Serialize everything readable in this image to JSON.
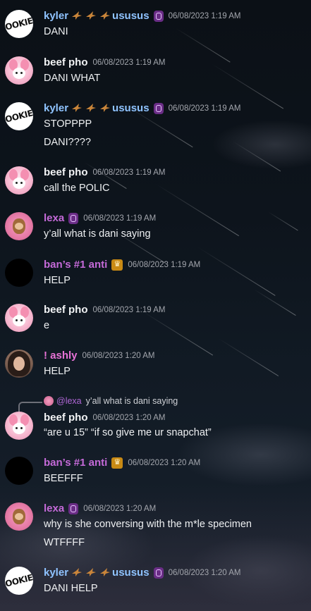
{
  "messages": [
    {
      "author": "kyler",
      "suffix": "ususus",
      "time": "06/08/2023 1:19 AM",
      "lines": [
        "DANI"
      ]
    },
    {
      "author": "beef pho",
      "time": "06/08/2023 1:19 AM",
      "lines": [
        "DANI WHAT"
      ]
    },
    {
      "author": "kyler",
      "suffix": "ususus",
      "time": "06/08/2023 1:19 AM",
      "lines": [
        "STOPPPP",
        "DANI????"
      ]
    },
    {
      "author": "beef pho",
      "time": "06/08/2023 1:19 AM",
      "lines": [
        "call the POLIC"
      ]
    },
    {
      "author": "lexa",
      "time": "06/08/2023 1:19 AM",
      "lines": [
        "y’all what is dani saying"
      ]
    },
    {
      "author": "ban’s #1 anti",
      "time": "06/08/2023 1:19 AM",
      "lines": [
        "HELP"
      ]
    },
    {
      "author": "beef pho",
      "time": "06/08/2023 1:19 AM",
      "lines": [
        "e"
      ]
    },
    {
      "author": "! ashly",
      "time": "06/08/2023 1:20 AM",
      "lines": [
        "HELP"
      ]
    },
    {
      "author": "beef pho",
      "time": "06/08/2023 1:20 AM",
      "reply": {
        "name": "@lexa",
        "text": "y’all what is dani saying"
      },
      "lines": [
        "“are u 15” “if so give me ur snapchat”"
      ]
    },
    {
      "author": "ban’s #1 anti",
      "time": "06/08/2023 1:20 AM",
      "lines": [
        "BEEFFF"
      ]
    },
    {
      "author": "lexa",
      "time": "06/08/2023 1:20 AM",
      "lines": [
        "why is she conversing with the m*le specimen",
        "WTFFFF"
      ]
    },
    {
      "author": "kyler",
      "suffix": "ususus",
      "time": "06/08/2023 1:20 AM",
      "lines": [
        "DANI HELP"
      ]
    }
  ],
  "avatar_text": {
    "cookie": "OOKIE"
  },
  "colors": {
    "kyler": "#8fc3ff",
    "lexa": "#c46ad8",
    "ban": "#c46ad8",
    "ashly": "#e873d6",
    "timestamp": "#a3a6ad"
  }
}
